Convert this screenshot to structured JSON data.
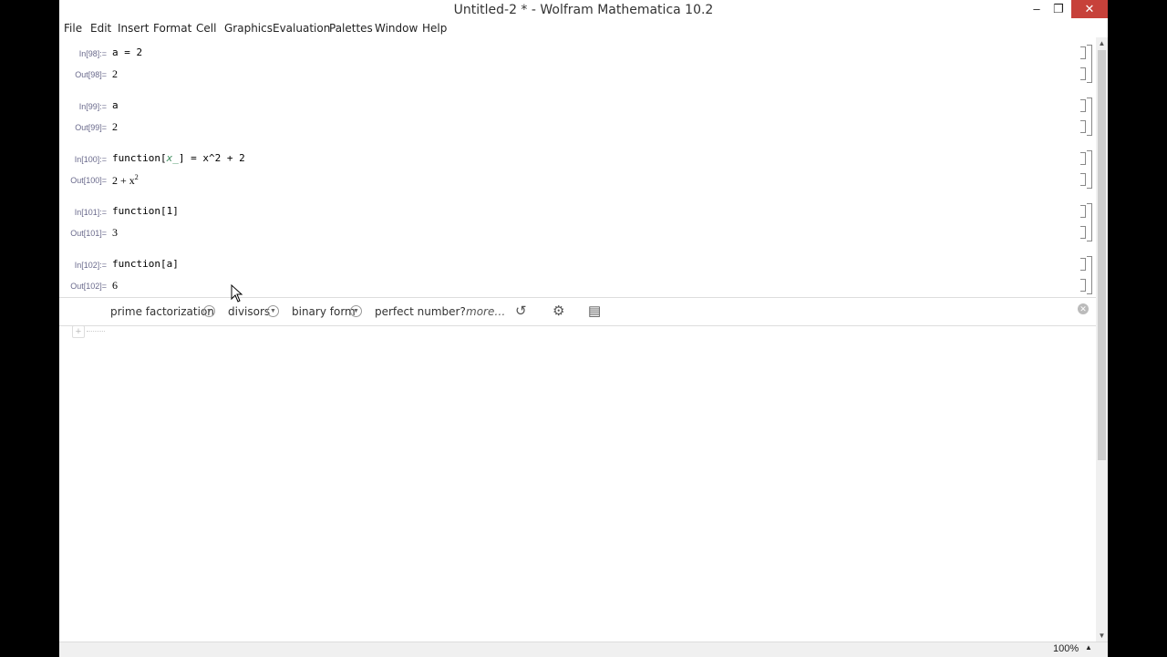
{
  "window": {
    "title": "Untitled-2 * - Wolfram Mathematica 10.2",
    "controls": {
      "minimize": "–",
      "restore": "❐",
      "close": "✕"
    }
  },
  "menu": [
    "File",
    "Edit",
    "Insert",
    "Format",
    "Cell",
    "Graphics",
    "Evaluation",
    "Palettes",
    "Window",
    "Help"
  ],
  "cells": [
    {
      "in_label": "In[98]:=",
      "input": "a = 2",
      "out_label": "Out[98]=",
      "output": "2"
    },
    {
      "in_label": "In[99]:=",
      "input": "a",
      "out_label": "Out[99]=",
      "output": "2"
    },
    {
      "in_label": "In[100]:=",
      "input_parts": {
        "head": "function[",
        "pattern": "x_",
        "rest": "] = x^2 + 2"
      },
      "out_label": "Out[100]=",
      "output_parts": {
        "base": "2 + x",
        "sup": "2"
      }
    },
    {
      "in_label": "In[101]:=",
      "input": "function[1]",
      "out_label": "Out[101]=",
      "output": "3"
    },
    {
      "in_label": "In[102]:=",
      "input": "function[a]",
      "out_label": "Out[102]=",
      "output": "6"
    }
  ],
  "suggestions": {
    "items": [
      "prime factorization",
      "divisors",
      "binary form",
      "perfect number?"
    ],
    "more": "more…"
  },
  "status": {
    "zoom": "100%"
  },
  "icons": {
    "app": "mathematica-logo-icon",
    "colors": {
      "close_button": "#c7413a",
      "cell_label": "#6a6a8c",
      "app_logo": "#e8711a"
    }
  }
}
